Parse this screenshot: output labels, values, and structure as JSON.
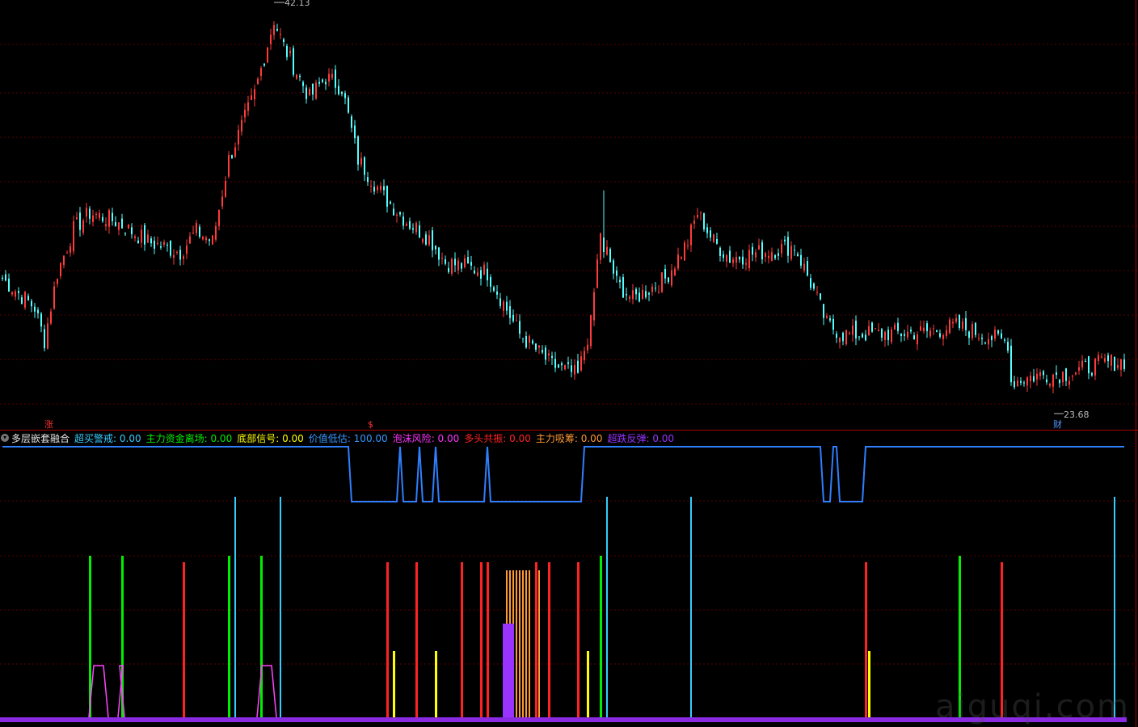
{
  "price_panel": {
    "high_label": "42.13",
    "low_label": "23.68",
    "markers": [
      {
        "text": "涨",
        "color": "#ff3333",
        "x_index": 14
      },
      {
        "text": "$",
        "color": "#ff3333",
        "x_index": 114
      },
      {
        "text": "财",
        "color": "#5599ff",
        "x_index": 326
      }
    ]
  },
  "indicator": {
    "name": "多层嵌套融合",
    "items": [
      {
        "label": "超买警戒",
        "value": "0.00",
        "color": "#33ccff"
      },
      {
        "label": "主力资金离场",
        "value": "0.00",
        "color": "#00ee00"
      },
      {
        "label": "底部信号",
        "value": "0.00",
        "color": "#ffff00"
      },
      {
        "label": "价值低估",
        "value": "100.00",
        "color": "#3399ff"
      },
      {
        "label": "泡沫风险",
        "value": "0.00",
        "color": "#ff33ff"
      },
      {
        "label": "多头共振",
        "value": "0.00",
        "color": "#ff2222"
      },
      {
        "label": "主力吸筹",
        "value": "0.00",
        "color": "#ff9933"
      },
      {
        "label": "超跌反弹",
        "value": "0.00",
        "color": "#9933ff"
      }
    ]
  },
  "watermark": "aiguqi.com",
  "chart_data": {
    "type": "candlestick",
    "bars": 348,
    "price_ylim": [
      22.8,
      42.6
    ],
    "price_anchors": [
      [
        0,
        29.2
      ],
      [
        10,
        27.8
      ],
      [
        13,
        26.2
      ],
      [
        17,
        29.5
      ],
      [
        22,
        31.6
      ],
      [
        27,
        32.4
      ],
      [
        35,
        32.0
      ],
      [
        45,
        31.0
      ],
      [
        55,
        30.5
      ],
      [
        60,
        31.5
      ],
      [
        65,
        31.0
      ],
      [
        70,
        35.0
      ],
      [
        78,
        38.2
      ],
      [
        84,
        41.8
      ],
      [
        87,
        40.5
      ],
      [
        95,
        38.0
      ],
      [
        100,
        39.0
      ],
      [
        105,
        38.5
      ],
      [
        110,
        35.0
      ],
      [
        118,
        33.2
      ],
      [
        125,
        32.0
      ],
      [
        132,
        31.2
      ],
      [
        137,
        30.0
      ],
      [
        143,
        29.8
      ],
      [
        150,
        29.5
      ],
      [
        155,
        28.0
      ],
      [
        160,
        26.5
      ],
      [
        170,
        25.0
      ],
      [
        178,
        24.5
      ],
      [
        182,
        27.0
      ],
      [
        185,
        31.5
      ],
      [
        190,
        29.0
      ],
      [
        195,
        28.2
      ],
      [
        205,
        29.2
      ],
      [
        212,
        31.0
      ],
      [
        215,
        32.4
      ],
      [
        220,
        31.0
      ],
      [
        225,
        30.2
      ],
      [
        235,
        30.5
      ],
      [
        245,
        30.8
      ],
      [
        250,
        29.0
      ],
      [
        255,
        27.0
      ],
      [
        260,
        26.5
      ],
      [
        265,
        26.5
      ],
      [
        285,
        26.6
      ],
      [
        295,
        26.9
      ],
      [
        305,
        26.4
      ],
      [
        311,
        26.1
      ],
      [
        312,
        24.2
      ],
      [
        320,
        24.5
      ],
      [
        330,
        24.6
      ],
      [
        340,
        25.1
      ],
      [
        347,
        25.2
      ]
    ],
    "spikes": [
      {
        "index": 186,
        "high": 33.5,
        "close": 30.5
      },
      {
        "index": 217,
        "high": 32.2,
        "close": 31.6
      }
    ],
    "status_line_blue": {
      "levels": [
        "high",
        "low"
      ],
      "low_segments": [
        [
          108,
          118
        ],
        [
          119,
          122
        ],
        [
          124,
          128
        ],
        [
          130,
          133
        ],
        [
          135,
          149
        ],
        [
          151,
          179
        ],
        [
          254,
          256
        ],
        [
          259,
          266
        ]
      ]
    },
    "signal_bars": {
      "超买警戒": [
        72,
        86,
        187,
        213,
        344
      ],
      "主力资金离场": [
        27,
        37,
        70,
        80,
        185,
        296
      ],
      "多头共振": [
        56,
        119,
        128,
        142,
        148,
        150,
        165,
        169,
        178,
        267,
        309
      ],
      "底部信号": [
        121,
        134,
        181,
        268
      ],
      "主力吸筹": [
        156,
        157,
        158,
        159,
        160,
        161,
        162,
        163,
        166
      ],
      "超跌反弹": [
        155,
        156,
        157
      ]
    },
    "bubble_risk_humps": [
      [
        27,
        33
      ],
      [
        36,
        38
      ],
      [
        79,
        85
      ]
    ]
  }
}
